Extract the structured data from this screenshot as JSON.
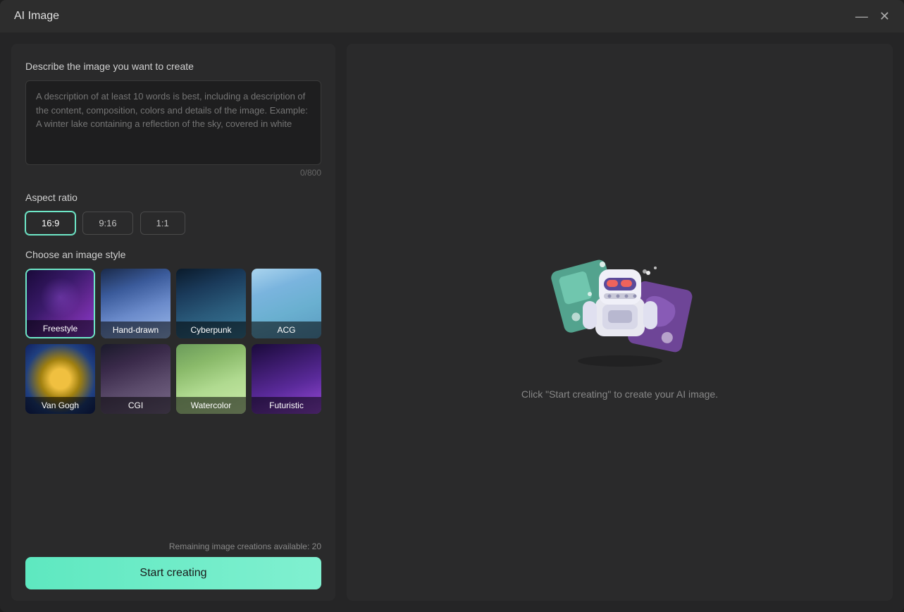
{
  "window": {
    "title": "AI Image"
  },
  "left": {
    "description_label": "Describe the image you want to create",
    "description_placeholder": "A description of at least 10 words is best, including a description of the content, composition, colors and details of the image. Example: A winter lake containing a reflection of the sky, covered in white",
    "char_count": "0/800",
    "aspect_ratio_label": "Aspect ratio",
    "aspect_options": [
      "16:9",
      "9:16",
      "1:1"
    ],
    "aspect_selected": "16:9",
    "style_label": "Choose an image style",
    "styles": [
      {
        "id": "freestyle",
        "label": "Freestyle",
        "selected": true
      },
      {
        "id": "handdrawn",
        "label": "Hand-drawn",
        "selected": false
      },
      {
        "id": "cyberpunk",
        "label": "Cyberpunk",
        "selected": false
      },
      {
        "id": "acg",
        "label": "ACG",
        "selected": false
      },
      {
        "id": "vangogh",
        "label": "Van Gogh",
        "selected": false
      },
      {
        "id": "cgi",
        "label": "CGI",
        "selected": false
      },
      {
        "id": "watercolor",
        "label": "Watercolor",
        "selected": false
      },
      {
        "id": "futuristic",
        "label": "Futuristic",
        "selected": false
      }
    ],
    "remaining_text": "Remaining image creations available: 20",
    "start_btn_label": "Start creating"
  },
  "right": {
    "hint": "Click \"Start creating\" to create your AI image."
  },
  "icons": {
    "minimize": "—",
    "close": "✕"
  }
}
